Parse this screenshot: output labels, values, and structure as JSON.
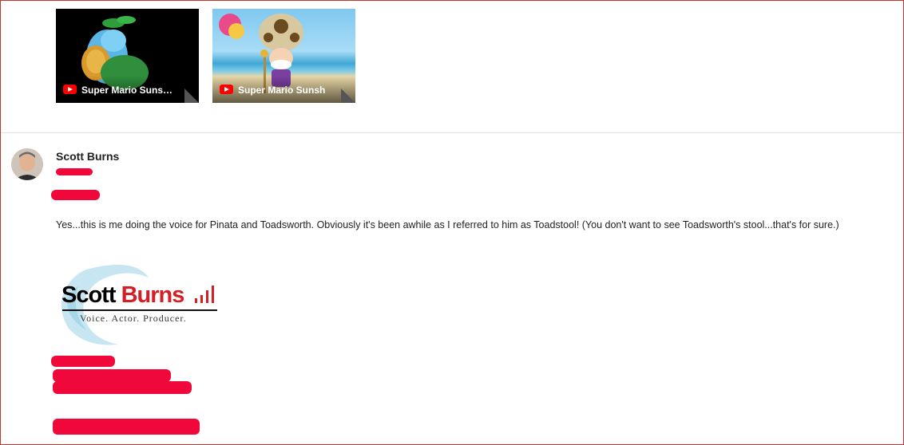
{
  "videos": [
    {
      "title": "Super Mario Sunsh...",
      "icon": "youtube-icon"
    },
    {
      "title": "Super Mario Sunsh",
      "icon": "youtube-icon"
    }
  ],
  "comment": {
    "author": "Scott Burns",
    "text": "Yes...this is me doing the voice for Pinata and Toadsworth.   Obviously it's been awhile as I referred to him as Toadstool!   (You don't want to see Toadsworth's stool...that's for sure.)"
  },
  "signature": {
    "logo_text_first": "Scott",
    "logo_text_last": "Burns",
    "tagline": "Voice. Actor. Producer."
  },
  "colors": {
    "redaction": "#f0083a",
    "youtube": "#ff0000",
    "frame_border": "#c0392b"
  }
}
